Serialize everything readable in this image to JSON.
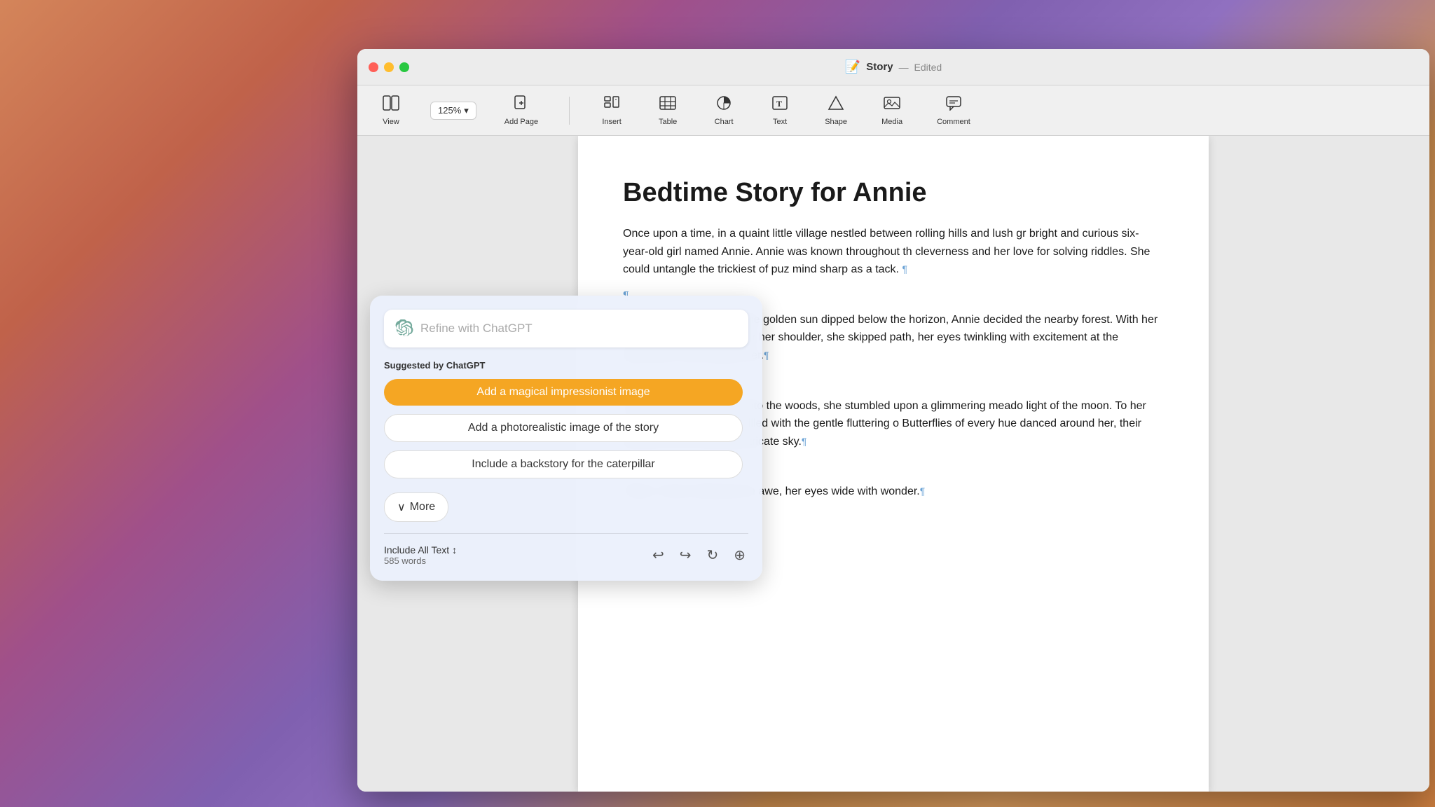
{
  "desktop": {
    "background": "macOS Monterey gradient"
  },
  "window": {
    "title": "Story",
    "subtitle": "Edited",
    "icon": "📝"
  },
  "titlebar": {
    "close_label": "close",
    "minimize_label": "minimize",
    "maximize_label": "maximize",
    "title": "Story",
    "dash": "—",
    "edited": "Edited"
  },
  "toolbar": {
    "zoom_value": "125%",
    "zoom_chevron": "▾",
    "items": [
      {
        "id": "view",
        "icon": "⊞",
        "label": "View"
      },
      {
        "id": "zoom",
        "value": "125%",
        "label": "Zoom"
      },
      {
        "id": "add-page",
        "icon": "⊕",
        "label": "Add Page"
      },
      {
        "id": "insert",
        "icon": "≡+",
        "label": "Insert"
      },
      {
        "id": "table",
        "icon": "⊞",
        "label": "Table"
      },
      {
        "id": "chart",
        "icon": "⏱",
        "label": "Chart"
      },
      {
        "id": "text",
        "icon": "T",
        "label": "Text"
      },
      {
        "id": "shape",
        "icon": "△",
        "label": "Shape"
      },
      {
        "id": "media",
        "icon": "🖼",
        "label": "Media"
      },
      {
        "id": "comment",
        "icon": "💬",
        "label": "Comment"
      }
    ]
  },
  "document": {
    "title": "Bedtime Story for Annie",
    "paragraphs": [
      {
        "id": "p1",
        "text": "Once upon a time, in a quaint little village nestled between rolling hills and lush gr bright and curious six-year-old girl named Annie. Annie was known throughout th cleverness and her love for solving riddles. She could untangle the trickiest of puz mind sharp as a tack.",
        "mark": true
      },
      {
        "id": "p2",
        "text": "One breezy evening, as the golden sun dipped below the horizon, Annie decided the nearby forest. With her trusty backpack slung over her shoulder, she skipped path, her eyes twinkling with excitement at the adventures that awaited her.",
        "mark": true
      },
      {
        "id": "p3",
        "text": "As she ventured deeper into the woods, she stumbled upon a glimmering meado light of the moon. To her amazement, the air was filled with the gentle fluttering o Butterflies of every hue danced around her, their delicate forms weaving intricate sky.",
        "mark": true
      },
      {
        "id": "p4",
        "text": "\"Wow,\" Annie whispered in awe, her eyes wide with wonder.",
        "mark": true
      }
    ]
  },
  "chatgpt_panel": {
    "input_placeholder": "Refine with ChatGPT",
    "suggested_label": "Suggested by ChatGPT",
    "suggestions": [
      {
        "id": "s1",
        "text": "Add a magical impressionist image",
        "active": true
      },
      {
        "id": "s2",
        "text": "Add a photorealistic image of the story",
        "active": false
      },
      {
        "id": "s3",
        "text": "Include a backstory for the caterpillar",
        "active": false
      }
    ],
    "more_label": "More",
    "more_chevron": "∨",
    "footer": {
      "include_text": "Include All Text",
      "include_chevron": "↕",
      "word_count": "585 words"
    },
    "footer_actions": {
      "undo": "↩",
      "redo": "↪",
      "refresh": "↻",
      "add": "⊕"
    }
  }
}
